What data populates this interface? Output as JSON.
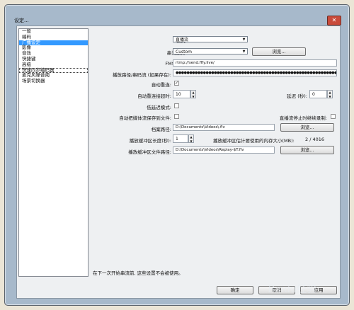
{
  "window": {
    "title": "设定...",
    "close_label": "✕"
  },
  "sidebar": {
    "items": [
      {
        "label": "一般"
      },
      {
        "label": "编码"
      },
      {
        "label": "广播设定"
      },
      {
        "label": "影像"
      },
      {
        "label": "音效"
      },
      {
        "label": "快捷键"
      },
      {
        "label": "高级"
      },
      {
        "label": "快速同步编码器"
      },
      {
        "label": "麦克风噪音阈"
      },
      {
        "label": "场景切换器"
      }
    ],
    "selected_index": 2
  },
  "form": {
    "mode_label": "模式:",
    "mode_value": "直播流",
    "service_label": "串流服务:",
    "service_value": "Custom",
    "browse_label": "浏览...",
    "fms_label": "FMS URL:",
    "fms_value": "rtmp://send.ffly.live/",
    "key_label": "播放路径/串码流 (如果存在):",
    "key_value": "●●●●●●●●●●●●●●●●●●●●●●●●●●●●●●●●●●●●●●●●●●●●●●●●●●●●●●●●●●●●●●●●●●●",
    "auto_reconnect_label": "自动重连:",
    "auto_reconnect_checked": true,
    "reconnect_timeout_label": "自动重连接超时:",
    "reconnect_timeout_value": "10",
    "delay_label": "延迟 (秒):",
    "delay_value": "0",
    "low_latency_label": "低延迟模式:",
    "save_to_file_label": "自动把媒体流保存到文件:",
    "keep_recording_label": "直播流停止时继续录制:",
    "file_path_label": "档案路径:",
    "file_path_value": "D:\\Documents\\Videos\\.flv",
    "browse2_label": "浏览...",
    "replay_len_label": "播放缓冲区长度(秒):",
    "replay_len_value": "1",
    "replay_mem_label": "播放缓冲区估计要使用的内存大小(MB):",
    "replay_mem_value": "2 / 4016",
    "replay_path_label": "播放缓冲区文件路径:",
    "replay_path_value": "D:\\Documents\\Videos\\Replay-$T.flv",
    "browse3_label": "浏览..."
  },
  "notice": "在下一次开始串流前, 这些设置不会被使用。",
  "footer": {
    "ok_label": "确定",
    "cancel_label": "取消",
    "apply_label": "应用"
  },
  "watermark": "Baidu经验"
}
